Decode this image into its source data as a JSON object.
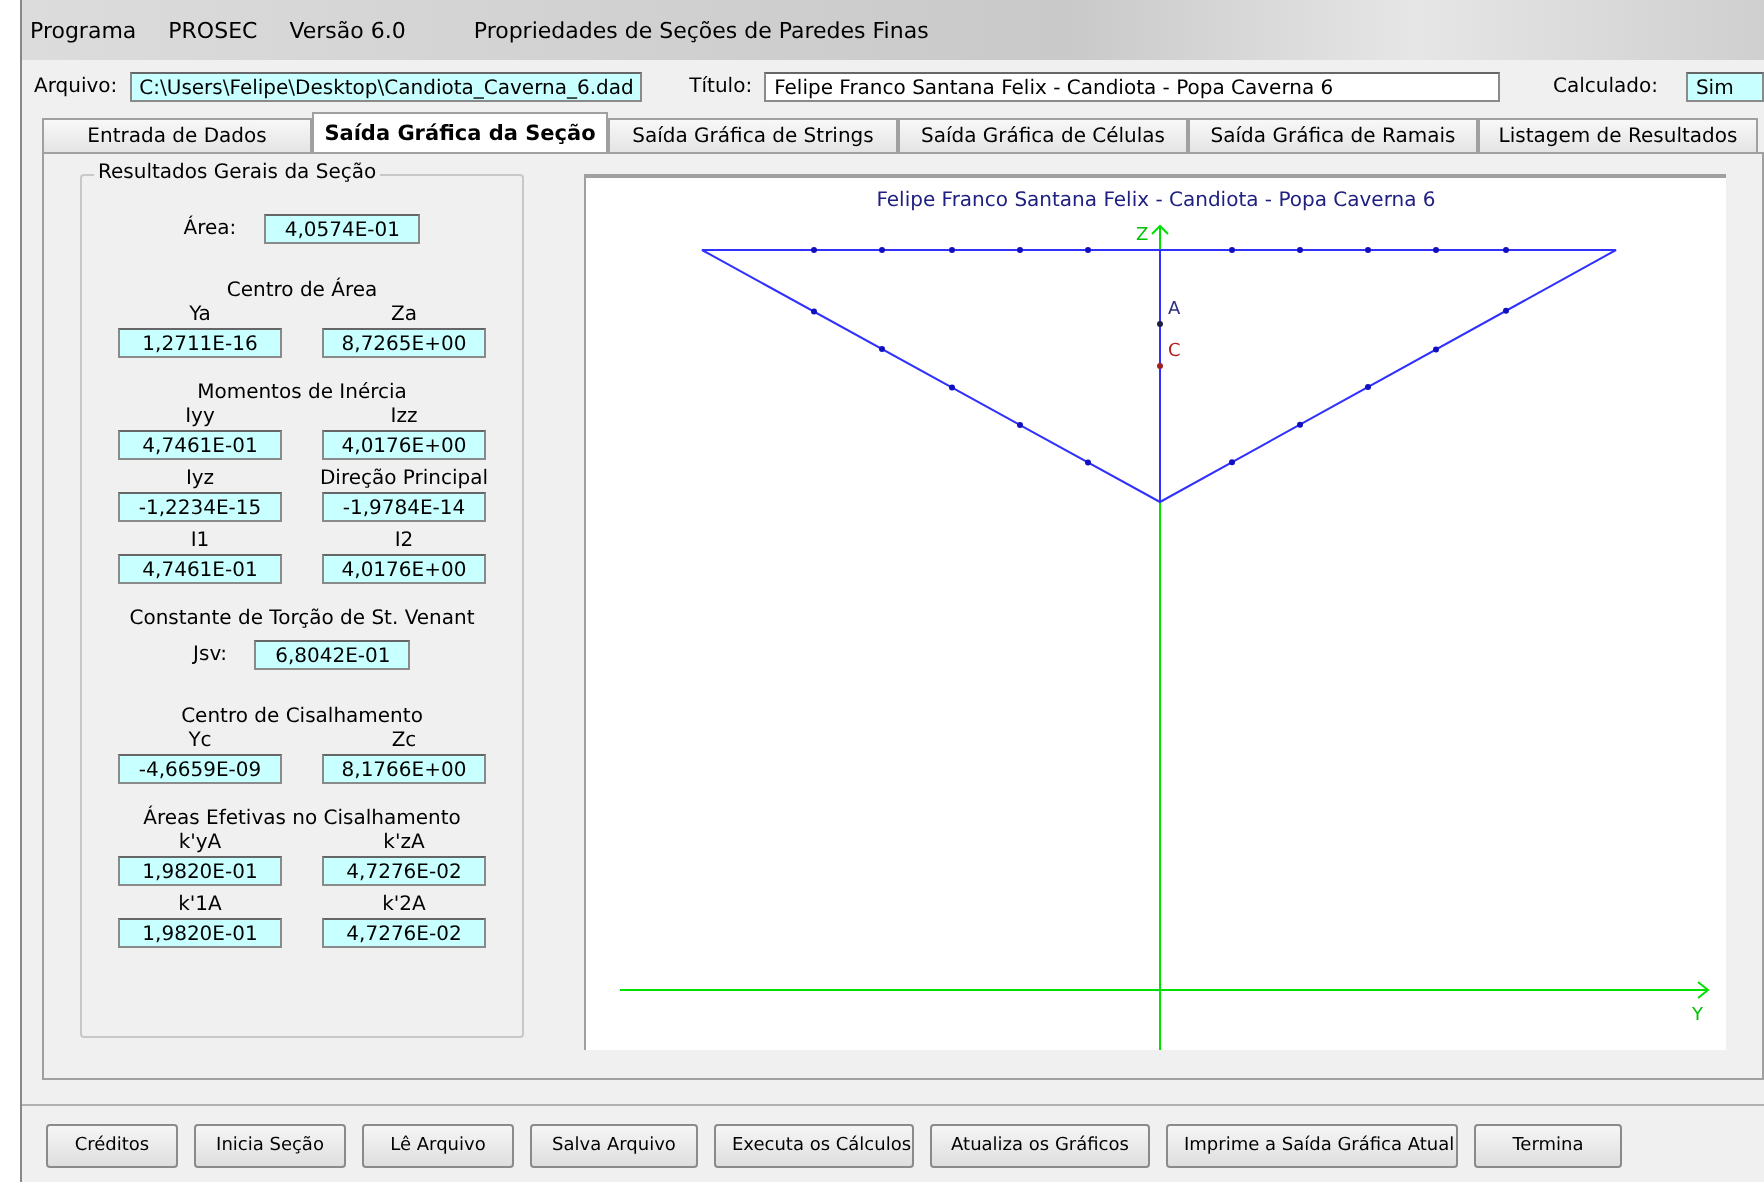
{
  "title_bar": [
    "Programa",
    "PROSEC",
    "Versão 6.0",
    "Propriedades de Seções de Paredes Finas"
  ],
  "header": {
    "file_label": "Arquivo:",
    "file_value": "C:\\Users\\Felipe\\Desktop\\Candiota_Caverna_6.dad",
    "title_label": "Título:",
    "title_value": "Felipe Franco Santana Felix - Candiota - Popa Caverna 6",
    "calc_label": "Calculado:",
    "calc_value": "Sim"
  },
  "tabs": [
    {
      "label": "Entrada de Dados",
      "selected": false
    },
    {
      "label": "Saída Gráfica da Seção",
      "selected": true
    },
    {
      "label": "Saída Gráfica de Strings",
      "selected": false
    },
    {
      "label": "Saída Gráfica de Células",
      "selected": false
    },
    {
      "label": "Saída Gráfica de Ramais",
      "selected": false
    },
    {
      "label": "Listagem de Resultados",
      "selected": false
    }
  ],
  "results": {
    "title": "Resultados Gerais da Seção",
    "sections": [
      {
        "kind": "inline",
        "label": "Área:",
        "value": "4,0574E-01"
      },
      {
        "kind": "heading",
        "text": "Centro de Área"
      },
      {
        "kind": "pair",
        "items": [
          {
            "label": "Ya",
            "value": "1,2711E-16"
          },
          {
            "label": "Za",
            "value": "8,7265E+00"
          }
        ]
      },
      {
        "kind": "heading",
        "text": "Momentos de Inércia"
      },
      {
        "kind": "pair",
        "items": [
          {
            "label": "Iyy",
            "value": "4,7461E-01"
          },
          {
            "label": "Izz",
            "value": "4,0176E+00"
          }
        ]
      },
      {
        "kind": "pair",
        "items": [
          {
            "label": "Iyz",
            "value": "-1,2234E-15"
          },
          {
            "label": "Direção Principal",
            "value": "-1,9784E-14"
          }
        ]
      },
      {
        "kind": "pair",
        "items": [
          {
            "label": "I1",
            "value": "4,7461E-01"
          },
          {
            "label": "I2",
            "value": "4,0176E+00"
          }
        ]
      },
      {
        "kind": "heading",
        "text": "Constante de Torção de St. Venant"
      },
      {
        "kind": "inline",
        "label": "Jsv:",
        "value": "6,8042E-01"
      },
      {
        "kind": "heading",
        "text": "Centro de Cisalhamento"
      },
      {
        "kind": "pair",
        "items": [
          {
            "label": "Yc",
            "value": "-4,6659E-09"
          },
          {
            "label": "Zc",
            "value": "8,1766E+00"
          }
        ]
      },
      {
        "kind": "heading",
        "text": "Áreas Efetivas no Cisalhamento"
      },
      {
        "kind": "pair",
        "items": [
          {
            "label": "k'yA",
            "value": "1,9820E-01"
          },
          {
            "label": "k'zA",
            "value": "4,7276E-02"
          }
        ]
      },
      {
        "kind": "pair",
        "items": [
          {
            "label": "k'1A",
            "value": "1,9820E-01"
          },
          {
            "label": "k'2A",
            "value": "4,7276E-02"
          }
        ]
      }
    ]
  },
  "plot": {
    "title": "Felipe Franco Santana Felix - Candiota - Popa Caverna 6",
    "z_label": "Z",
    "y_label": "Y",
    "area_center_label": "A",
    "shear_center_label": "C"
  },
  "buttons": [
    "Créditos",
    "Inicia Seção",
    "Lê Arquivo",
    "Salva Arquivo",
    "Executa os Cálculos",
    "Atualiza os Gráficos",
    "Imprime a Saída Gráfica Atual",
    "Termina"
  ]
}
